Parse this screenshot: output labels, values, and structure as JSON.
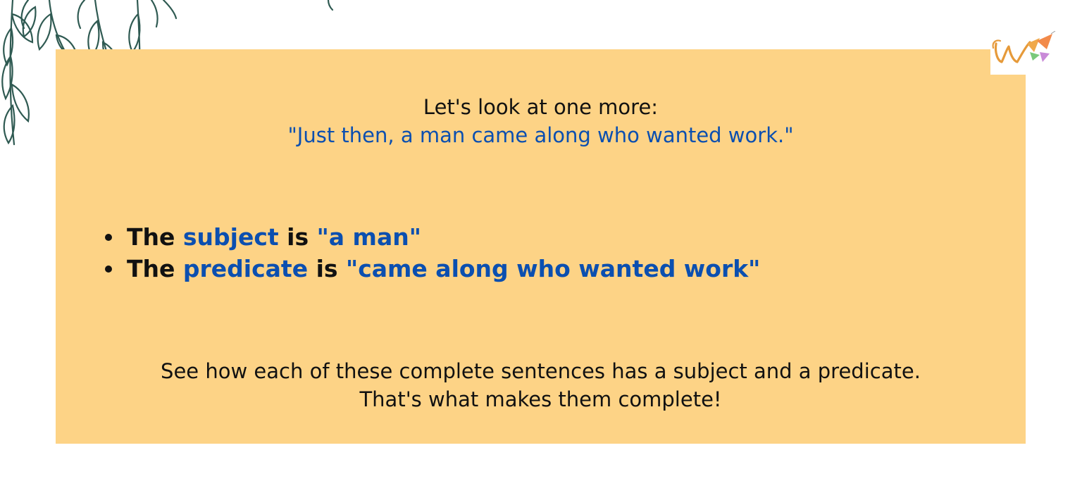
{
  "intro": {
    "line1": "Let's look at one more:",
    "quote": "\"Just then, a man came along who wanted work.\""
  },
  "bullets": [
    {
      "lead": "The ",
      "term": "subject",
      "mid": " is ",
      "value": "\"a man\""
    },
    {
      "lead": "The ",
      "term": "predicate",
      "mid": " is ",
      "value": "\"came along who wanted work\""
    }
  ],
  "outro": {
    "line1": "See how each of these complete sentences has a subject and a predicate.",
    "line2": "That's what makes them complete!"
  },
  "icons": {
    "logo": "w-logo-icon",
    "decoration": "leaf-branch-icon"
  },
  "colors": {
    "card": "#fdd386",
    "accent_blue": "#0b4fb0",
    "text": "#111111",
    "leaf": "#2f5a52"
  }
}
